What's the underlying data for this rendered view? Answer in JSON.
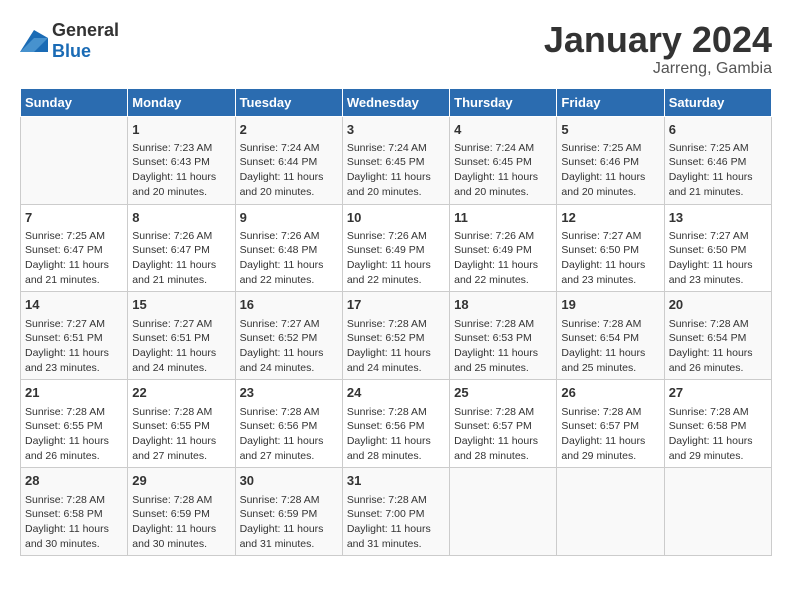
{
  "logo": {
    "general": "General",
    "blue": "Blue"
  },
  "title": "January 2024",
  "subtitle": "Jarreng, Gambia",
  "columns": [
    "Sunday",
    "Monday",
    "Tuesday",
    "Wednesday",
    "Thursday",
    "Friday",
    "Saturday"
  ],
  "weeks": [
    [
      {
        "day": "",
        "info": ""
      },
      {
        "day": "1",
        "info": "Sunrise: 7:23 AM\nSunset: 6:43 PM\nDaylight: 11 hours\nand 20 minutes."
      },
      {
        "day": "2",
        "info": "Sunrise: 7:24 AM\nSunset: 6:44 PM\nDaylight: 11 hours\nand 20 minutes."
      },
      {
        "day": "3",
        "info": "Sunrise: 7:24 AM\nSunset: 6:45 PM\nDaylight: 11 hours\nand 20 minutes."
      },
      {
        "day": "4",
        "info": "Sunrise: 7:24 AM\nSunset: 6:45 PM\nDaylight: 11 hours\nand 20 minutes."
      },
      {
        "day": "5",
        "info": "Sunrise: 7:25 AM\nSunset: 6:46 PM\nDaylight: 11 hours\nand 20 minutes."
      },
      {
        "day": "6",
        "info": "Sunrise: 7:25 AM\nSunset: 6:46 PM\nDaylight: 11 hours\nand 21 minutes."
      }
    ],
    [
      {
        "day": "7",
        "info": "Sunrise: 7:25 AM\nSunset: 6:47 PM\nDaylight: 11 hours\nand 21 minutes."
      },
      {
        "day": "8",
        "info": "Sunrise: 7:26 AM\nSunset: 6:47 PM\nDaylight: 11 hours\nand 21 minutes."
      },
      {
        "day": "9",
        "info": "Sunrise: 7:26 AM\nSunset: 6:48 PM\nDaylight: 11 hours\nand 22 minutes."
      },
      {
        "day": "10",
        "info": "Sunrise: 7:26 AM\nSunset: 6:49 PM\nDaylight: 11 hours\nand 22 minutes."
      },
      {
        "day": "11",
        "info": "Sunrise: 7:26 AM\nSunset: 6:49 PM\nDaylight: 11 hours\nand 22 minutes."
      },
      {
        "day": "12",
        "info": "Sunrise: 7:27 AM\nSunset: 6:50 PM\nDaylight: 11 hours\nand 23 minutes."
      },
      {
        "day": "13",
        "info": "Sunrise: 7:27 AM\nSunset: 6:50 PM\nDaylight: 11 hours\nand 23 minutes."
      }
    ],
    [
      {
        "day": "14",
        "info": "Sunrise: 7:27 AM\nSunset: 6:51 PM\nDaylight: 11 hours\nand 23 minutes."
      },
      {
        "day": "15",
        "info": "Sunrise: 7:27 AM\nSunset: 6:51 PM\nDaylight: 11 hours\nand 24 minutes."
      },
      {
        "day": "16",
        "info": "Sunrise: 7:27 AM\nSunset: 6:52 PM\nDaylight: 11 hours\nand 24 minutes."
      },
      {
        "day": "17",
        "info": "Sunrise: 7:28 AM\nSunset: 6:52 PM\nDaylight: 11 hours\nand 24 minutes."
      },
      {
        "day": "18",
        "info": "Sunrise: 7:28 AM\nSunset: 6:53 PM\nDaylight: 11 hours\nand 25 minutes."
      },
      {
        "day": "19",
        "info": "Sunrise: 7:28 AM\nSunset: 6:54 PM\nDaylight: 11 hours\nand 25 minutes."
      },
      {
        "day": "20",
        "info": "Sunrise: 7:28 AM\nSunset: 6:54 PM\nDaylight: 11 hours\nand 26 minutes."
      }
    ],
    [
      {
        "day": "21",
        "info": "Sunrise: 7:28 AM\nSunset: 6:55 PM\nDaylight: 11 hours\nand 26 minutes."
      },
      {
        "day": "22",
        "info": "Sunrise: 7:28 AM\nSunset: 6:55 PM\nDaylight: 11 hours\nand 27 minutes."
      },
      {
        "day": "23",
        "info": "Sunrise: 7:28 AM\nSunset: 6:56 PM\nDaylight: 11 hours\nand 27 minutes."
      },
      {
        "day": "24",
        "info": "Sunrise: 7:28 AM\nSunset: 6:56 PM\nDaylight: 11 hours\nand 28 minutes."
      },
      {
        "day": "25",
        "info": "Sunrise: 7:28 AM\nSunset: 6:57 PM\nDaylight: 11 hours\nand 28 minutes."
      },
      {
        "day": "26",
        "info": "Sunrise: 7:28 AM\nSunset: 6:57 PM\nDaylight: 11 hours\nand 29 minutes."
      },
      {
        "day": "27",
        "info": "Sunrise: 7:28 AM\nSunset: 6:58 PM\nDaylight: 11 hours\nand 29 minutes."
      }
    ],
    [
      {
        "day": "28",
        "info": "Sunrise: 7:28 AM\nSunset: 6:58 PM\nDaylight: 11 hours\nand 30 minutes."
      },
      {
        "day": "29",
        "info": "Sunrise: 7:28 AM\nSunset: 6:59 PM\nDaylight: 11 hours\nand 30 minutes."
      },
      {
        "day": "30",
        "info": "Sunrise: 7:28 AM\nSunset: 6:59 PM\nDaylight: 11 hours\nand 31 minutes."
      },
      {
        "day": "31",
        "info": "Sunrise: 7:28 AM\nSunset: 7:00 PM\nDaylight: 11 hours\nand 31 minutes."
      },
      {
        "day": "",
        "info": ""
      },
      {
        "day": "",
        "info": ""
      },
      {
        "day": "",
        "info": ""
      }
    ]
  ]
}
